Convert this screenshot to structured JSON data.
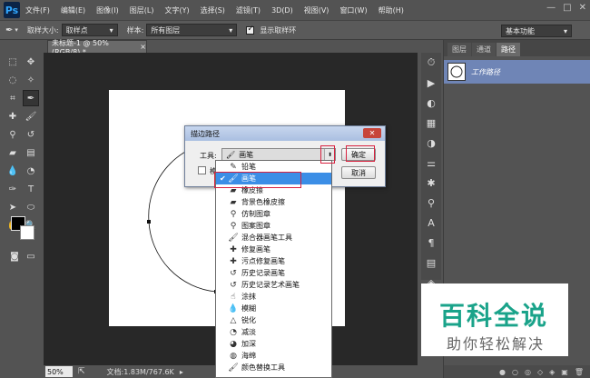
{
  "app": {
    "logo": "Ps"
  },
  "menu": [
    "文件(F)",
    "编辑(E)",
    "图像(I)",
    "图层(L)",
    "文字(Y)",
    "选择(S)",
    "滤镜(T)",
    "3D(D)",
    "视图(V)",
    "窗口(W)",
    "帮助(H)"
  ],
  "window_controls": {
    "minimize": "—",
    "restore": "□",
    "close": "✕"
  },
  "options": {
    "sample_size_label": "取样大小:",
    "sample_size_value": "取样点",
    "sample_label": "样本:",
    "sample_value": "所有图层",
    "show_ring_label": "显示取样环",
    "show_ring_checked": true,
    "workspace": "基本功能"
  },
  "document": {
    "tab_title": "未标题-1 @ 50%(RGB/8) *",
    "tab_close": "×"
  },
  "status": {
    "zoom": "50%",
    "doc_info": "文档:1.83M/767.6K"
  },
  "panel": {
    "tabs": [
      "图层",
      "通道",
      "路径"
    ],
    "active_tab": 2,
    "path_name": "工作路径",
    "bottom_icons": [
      "●",
      "○",
      "◎",
      "◇",
      "◈",
      "▣",
      "🗑"
    ]
  },
  "dialog": {
    "title": "描边路径",
    "close": "✕",
    "tool_label": "工具:",
    "tool_value": "画笔",
    "simulate_label": "模拟压力",
    "ok": "确定",
    "cancel": "取消"
  },
  "dropdown": {
    "items": [
      {
        "label": "铅笔",
        "icon": "✎",
        "selected": false
      },
      {
        "label": "画笔",
        "icon": "🖌",
        "selected": true
      },
      {
        "label": "橡皮擦",
        "icon": "▰",
        "selected": false
      },
      {
        "label": "背景色橡皮擦",
        "icon": "▰",
        "selected": false
      },
      {
        "label": "仿制图章",
        "icon": "⚲",
        "selected": false
      },
      {
        "label": "图案图章",
        "icon": "⚲",
        "selected": false
      },
      {
        "label": "混合器画笔工具",
        "icon": "🖌",
        "selected": false
      },
      {
        "label": "修复画笔",
        "icon": "✚",
        "selected": false
      },
      {
        "label": "污点修复画笔",
        "icon": "✚",
        "selected": false
      },
      {
        "label": "历史记录画笔",
        "icon": "↺",
        "selected": false
      },
      {
        "label": "历史记录艺术画笔",
        "icon": "↺",
        "selected": false
      },
      {
        "label": "涂抹",
        "icon": "☝",
        "selected": false
      },
      {
        "label": "模糊",
        "icon": "💧",
        "selected": false
      },
      {
        "label": "锐化",
        "icon": "△",
        "selected": false
      },
      {
        "label": "减淡",
        "icon": "◔",
        "selected": false
      },
      {
        "label": "加深",
        "icon": "◕",
        "selected": false
      },
      {
        "label": "海绵",
        "icon": "◍",
        "selected": false
      },
      {
        "label": "颜色替换工具",
        "icon": "🖌",
        "selected": false
      }
    ]
  },
  "watermark": {
    "title": "百科全说",
    "subtitle": "助你轻松解决"
  }
}
